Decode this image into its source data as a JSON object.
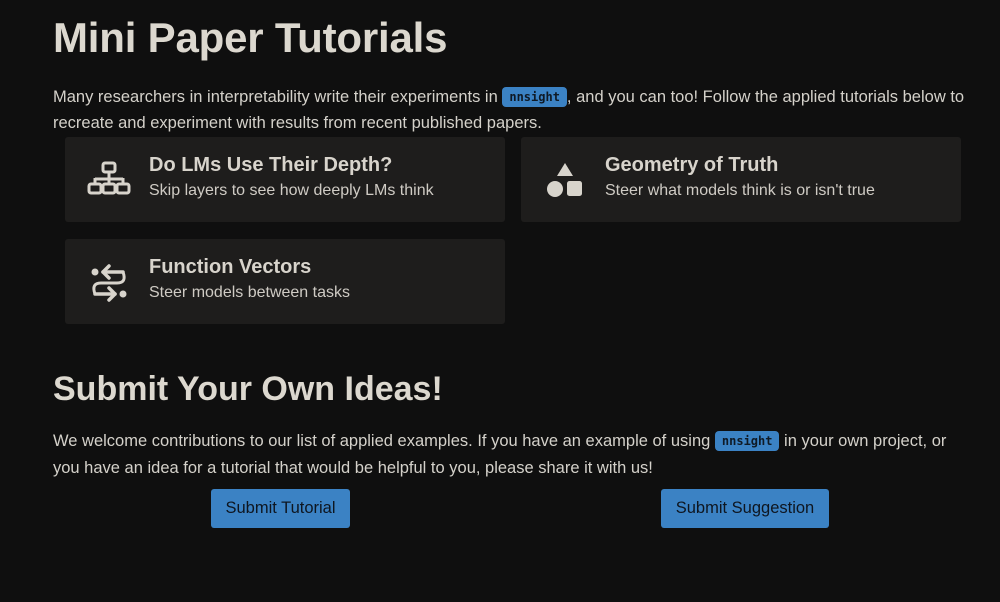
{
  "header": {
    "title": "Mini Paper Tutorials"
  },
  "intro": {
    "text_before": "Many researchers in interpretability write their experiments in ",
    "badge": "nnsight",
    "text_after": ", and you can too! Follow the applied tutorials below to recreate and experiment with results from recent published papers."
  },
  "tutorials": [
    {
      "title": "Do LMs Use Their Depth?",
      "subtitle": "Skip layers to see how deeply LMs think",
      "icon": "network-hierarchy-icon"
    },
    {
      "title": "Geometry of Truth",
      "subtitle": "Steer what models think is or isn't true",
      "icon": "shapes-icon"
    },
    {
      "title": "Function Vectors",
      "subtitle": "Steer models between tasks",
      "icon": "swap-arrows-icon"
    }
  ],
  "submit": {
    "title": "Submit Your Own Ideas!",
    "text_before": "We welcome contributions to our list of applied examples. If you have an example of using ",
    "badge": "nnsight",
    "text_after": " in your own project, or you have an idea for a tutorial that would be helpful to you, please share it with us!",
    "tutorial_button": "Submit Tutorial",
    "suggestion_button": "Submit Suggestion"
  },
  "colors": {
    "background": "#0f0f0f",
    "card": "#1e1d1c",
    "accent": "#3b82c4",
    "text": "#d6d3cd"
  }
}
